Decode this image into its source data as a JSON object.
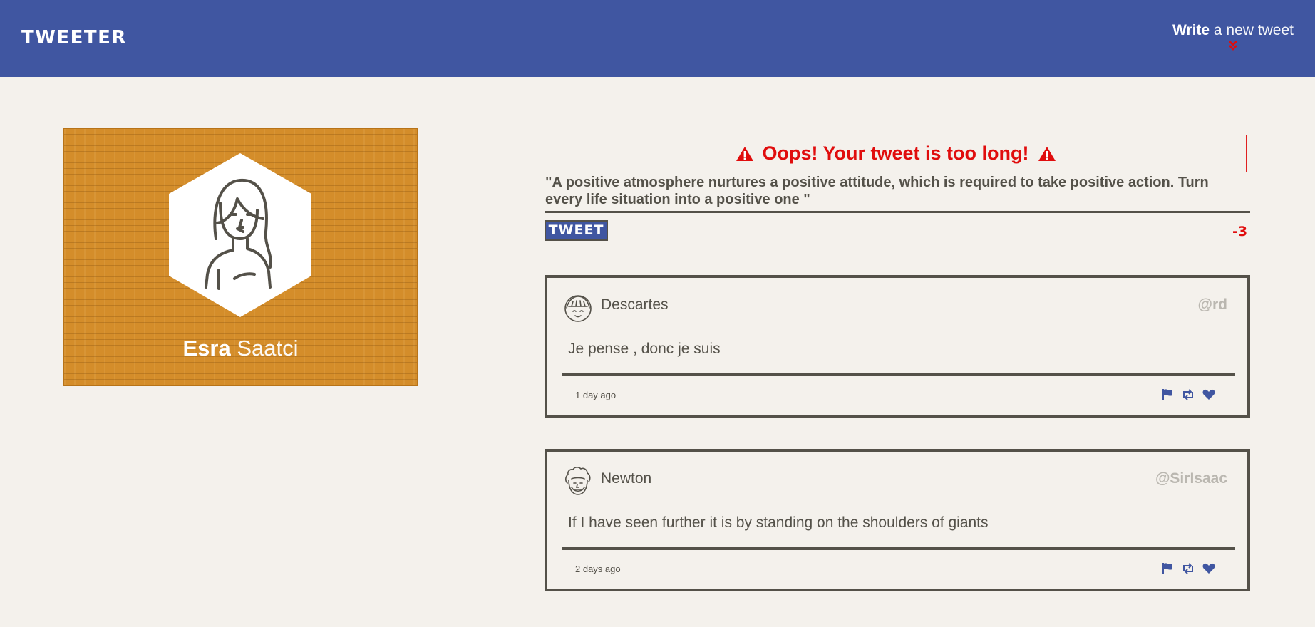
{
  "nav": {
    "brand": "TWEETER",
    "compose_bold": "Write",
    "compose_rest": "a new tweet"
  },
  "profile": {
    "first_name": "Esra",
    "last_name": "Saatci"
  },
  "composer": {
    "error_message": "Oops! Your tweet is too long!",
    "text": "\"A positive atmosphere nurtures a positive attitude, which is required to take positive action. Turn every life situation into a positive one \"",
    "button_label": "TWEET",
    "counter": "-3"
  },
  "tweets": [
    {
      "name": "Descartes",
      "handle": "@rd",
      "content": "Je pense , donc je suis",
      "time": "1 day ago"
    },
    {
      "name": "Newton",
      "handle": "@SirIsaac",
      "content": "If I have seen further it is by standing on the shoulders of giants",
      "time": "2 days ago"
    }
  ],
  "colors": {
    "navbar": "#4056a1",
    "background": "#f4f1ec",
    "profile_bg": "#d48d2a",
    "error": "#e00d0d",
    "text": "#545149",
    "handle": "#bab7b0"
  },
  "icons": {
    "compose": "double-chevron-down-icon",
    "warning": "warning-triangle-icon",
    "flag": "flag-icon",
    "retweet": "retweet-icon",
    "like": "heart-icon"
  }
}
